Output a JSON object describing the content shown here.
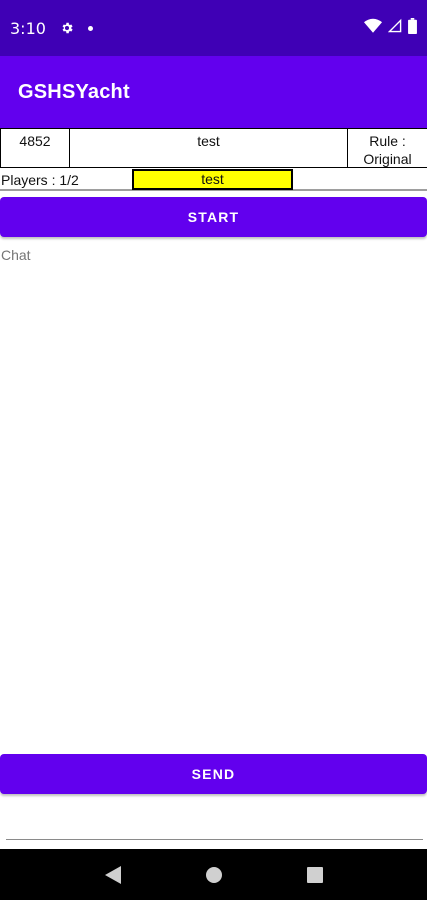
{
  "status_bar": {
    "time": "3:10",
    "icons": [
      "gear-icon",
      "notification-dot-icon",
      "wifi-icon",
      "signal-icon",
      "battery-icon"
    ]
  },
  "app_bar": {
    "title": "GSHSYacht",
    "color": "#6200ee"
  },
  "room": {
    "room_number": "4852",
    "room_name": "test",
    "rule_label": "Rule :",
    "rule_value": "Original"
  },
  "players": {
    "label": "Players : 1/2",
    "list": [
      "test"
    ],
    "highlight_color": "#ffff00"
  },
  "actions": {
    "start_label": "START",
    "send_label": "SEND"
  },
  "chat": {
    "label": "Chat",
    "messages": [],
    "input_value": ""
  },
  "nav_bar": {
    "icons": [
      "back-icon",
      "home-icon",
      "recents-icon"
    ]
  }
}
